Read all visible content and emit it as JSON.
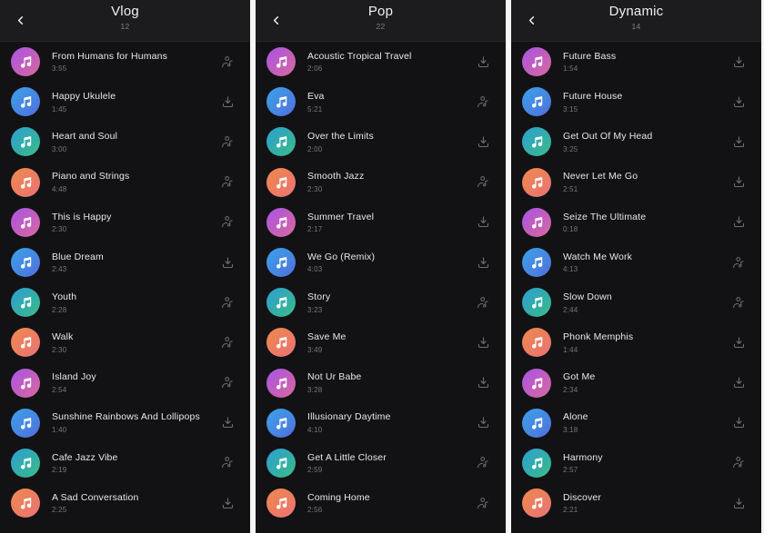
{
  "app": {
    "theme": "dark",
    "background": "#121214",
    "header_background": "#1c1c1f",
    "title_color": "#f0f0f2",
    "subtitle_color": "#7d7d84",
    "icon_color": "#6e6e76",
    "avatar_colors": {
      "purple": "#a855e8",
      "blue": "#3aa2e8",
      "teal": "#34b29c",
      "orange": "#ee8a4e"
    }
  },
  "icons": {
    "back": "chevron-left-icon",
    "avatar": "music-note-icon",
    "download": "download-icon",
    "artist": "artist-profile-icon"
  },
  "panels": [
    {
      "id": "panel-vlog",
      "back_label": "Back",
      "title": "Vlog",
      "count": "12",
      "tracks": [
        {
          "title": "From Humans for Humans",
          "duration": "3:55",
          "avatar": "purple",
          "action": "artist"
        },
        {
          "title": "Happy Ukulele",
          "duration": "1:45",
          "avatar": "blue",
          "action": "download"
        },
        {
          "title": "Heart and Soul",
          "duration": "3:00",
          "avatar": "teal",
          "action": "artist"
        },
        {
          "title": "Piano and Strings",
          "duration": "4:48",
          "avatar": "orange",
          "action": "artist"
        },
        {
          "title": "This is Happy",
          "duration": "2:30",
          "avatar": "purple",
          "action": "artist"
        },
        {
          "title": "Blue Dream",
          "duration": "2:43",
          "avatar": "blue",
          "action": "download"
        },
        {
          "title": "Youth",
          "duration": "2:28",
          "avatar": "teal",
          "action": "artist"
        },
        {
          "title": "Walk",
          "duration": "2:30",
          "avatar": "orange",
          "action": "artist"
        },
        {
          "title": "Island Joy",
          "duration": "2:54",
          "avatar": "purple",
          "action": "artist"
        },
        {
          "title": "Sunshine Rainbows And Lollipops",
          "duration": "1:40",
          "avatar": "blue",
          "action": "download"
        },
        {
          "title": "Cafe Jazz Vibe",
          "duration": "2:19",
          "avatar": "teal",
          "action": "artist"
        },
        {
          "title": "A Sad Conversation",
          "duration": "2:25",
          "avatar": "orange",
          "action": "download"
        }
      ]
    },
    {
      "id": "panel-pop",
      "back_label": "Back",
      "title": "Pop",
      "count": "22",
      "tracks": [
        {
          "title": "Acoustic Tropical Travel",
          "duration": "2:06",
          "avatar": "purple",
          "action": "download"
        },
        {
          "title": "Eva",
          "duration": "5:21",
          "avatar": "blue",
          "action": "artist"
        },
        {
          "title": "Over the Limits",
          "duration": "2:00",
          "avatar": "teal",
          "action": "download"
        },
        {
          "title": "Smooth Jazz",
          "duration": "2:30",
          "avatar": "orange",
          "action": "artist"
        },
        {
          "title": "Summer Travel",
          "duration": "2:17",
          "avatar": "purple",
          "action": "download"
        },
        {
          "title": "We Go (Remix)",
          "duration": "4:03",
          "avatar": "blue",
          "action": "download"
        },
        {
          "title": "Story",
          "duration": "3:23",
          "avatar": "teal",
          "action": "artist"
        },
        {
          "title": "Save Me",
          "duration": "3:49",
          "avatar": "orange",
          "action": "download"
        },
        {
          "title": "Not Ur Babe",
          "duration": "3:28",
          "avatar": "purple",
          "action": "download"
        },
        {
          "title": "Illusionary Daytime",
          "duration": "4:10",
          "avatar": "blue",
          "action": "download"
        },
        {
          "title": "Get A Little Closer",
          "duration": "2:59",
          "avatar": "teal",
          "action": "artist"
        },
        {
          "title": "Coming Home",
          "duration": "2:56",
          "avatar": "orange",
          "action": "artist"
        }
      ]
    },
    {
      "id": "panel-dynamic",
      "back_label": "Back",
      "title": "Dynamic",
      "count": "14",
      "tracks": [
        {
          "title": "Future Bass",
          "duration": "1:54",
          "avatar": "purple",
          "action": "download"
        },
        {
          "title": "Future House",
          "duration": "3:15",
          "avatar": "blue",
          "action": "download"
        },
        {
          "title": "Get Out Of My Head",
          "duration": "3:25",
          "avatar": "teal",
          "action": "download"
        },
        {
          "title": "Never Let Me Go",
          "duration": "2:51",
          "avatar": "orange",
          "action": "download"
        },
        {
          "title": "Seize The Ultimate",
          "duration": "0:18",
          "avatar": "purple",
          "action": "download"
        },
        {
          "title": "Watch Me Work",
          "duration": "4:13",
          "avatar": "blue",
          "action": "artist"
        },
        {
          "title": "Slow Down",
          "duration": "2:44",
          "avatar": "teal",
          "action": "artist"
        },
        {
          "title": "Phonk Memphis",
          "duration": "1:44",
          "avatar": "orange",
          "action": "download"
        },
        {
          "title": "Got Me",
          "duration": "2:34",
          "avatar": "purple",
          "action": "download"
        },
        {
          "title": "Alone",
          "duration": "3:18",
          "avatar": "blue",
          "action": "download"
        },
        {
          "title": "Harmony",
          "duration": "2:57",
          "avatar": "teal",
          "action": "artist"
        },
        {
          "title": "Discover",
          "duration": "2:21",
          "avatar": "orange",
          "action": "download"
        }
      ]
    }
  ]
}
